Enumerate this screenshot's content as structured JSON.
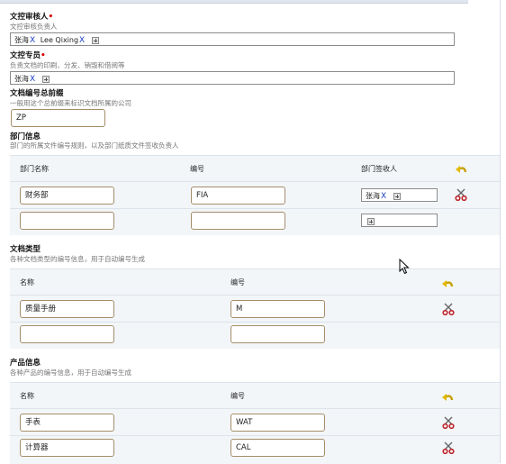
{
  "reviewer": {
    "label": "文控审核人",
    "hint": "文控审核负责人",
    "users": [
      "张海",
      "Lee Qixing"
    ]
  },
  "specialist": {
    "label": "文控专员",
    "hint": "负责文档的印刷、分发、销毁和借阅等",
    "users": [
      "张海"
    ]
  },
  "doc_prefix": {
    "label": "文档编号总前缀",
    "hint": "一般用这个总前缀来标识文档所属的公司",
    "value": "ZP"
  },
  "departments": {
    "label": "部门信息",
    "hint": "部门的所属文件编号规则，以及部门纸质文件签收负责人",
    "columns": [
      "部门名称",
      "编号",
      "部门签收人"
    ],
    "rows": [
      {
        "name": "财务部",
        "code": "FIA",
        "receiver": "张海"
      },
      {
        "name": "",
        "code": "",
        "receiver": ""
      }
    ]
  },
  "doc_types": {
    "label": "文档类型",
    "hint": "各种文档类型的编号信息，用于自动编号生成",
    "columns": [
      "名称",
      "编号"
    ],
    "rows": [
      {
        "name": "质量手册",
        "code": "M"
      },
      {
        "name": "",
        "code": ""
      }
    ]
  },
  "products": {
    "label": "产品信息",
    "hint": "各种产品的编号信息，用于自动编号生成",
    "columns": [
      "名称",
      "编号"
    ],
    "rows": [
      {
        "name": "手表",
        "code": "WAT"
      },
      {
        "name": "计算器",
        "code": "CAL"
      }
    ]
  },
  "remove_glyph": "X"
}
